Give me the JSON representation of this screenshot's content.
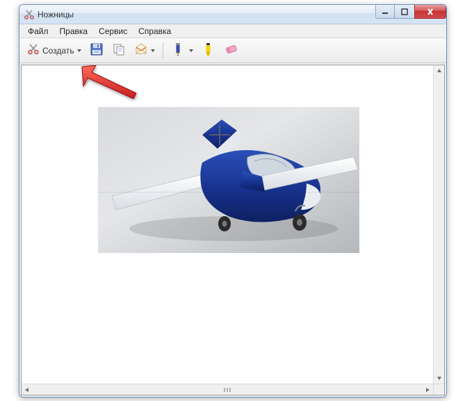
{
  "titlebar": {
    "title": "Ножницы"
  },
  "menu": {
    "file": "Файл",
    "edit": "Правка",
    "service": "Сервис",
    "help": "Справка"
  },
  "toolbar": {
    "new_label": "Создать",
    "save_label": "Сохранить",
    "copy_label": "Копировать",
    "send_label": "Отправить",
    "pen_label": "Перо",
    "highlighter_label": "Маркер",
    "eraser_label": "Резинка"
  },
  "icons": {
    "app": "scissors-icon",
    "minimize": "minimize-icon",
    "maximize": "maximize-icon",
    "close": "close-icon",
    "new": "scissors-icon",
    "save": "floppy-icon",
    "copy": "copy-icon",
    "send": "envelope-icon",
    "pen": "pen-icon",
    "highlighter": "highlighter-icon",
    "eraser": "eraser-icon"
  },
  "colors": {
    "pen": "#3a4aa8",
    "highlighter": "#f2d400",
    "eraser": "#f5a6c7",
    "arrow": "#e23030"
  }
}
